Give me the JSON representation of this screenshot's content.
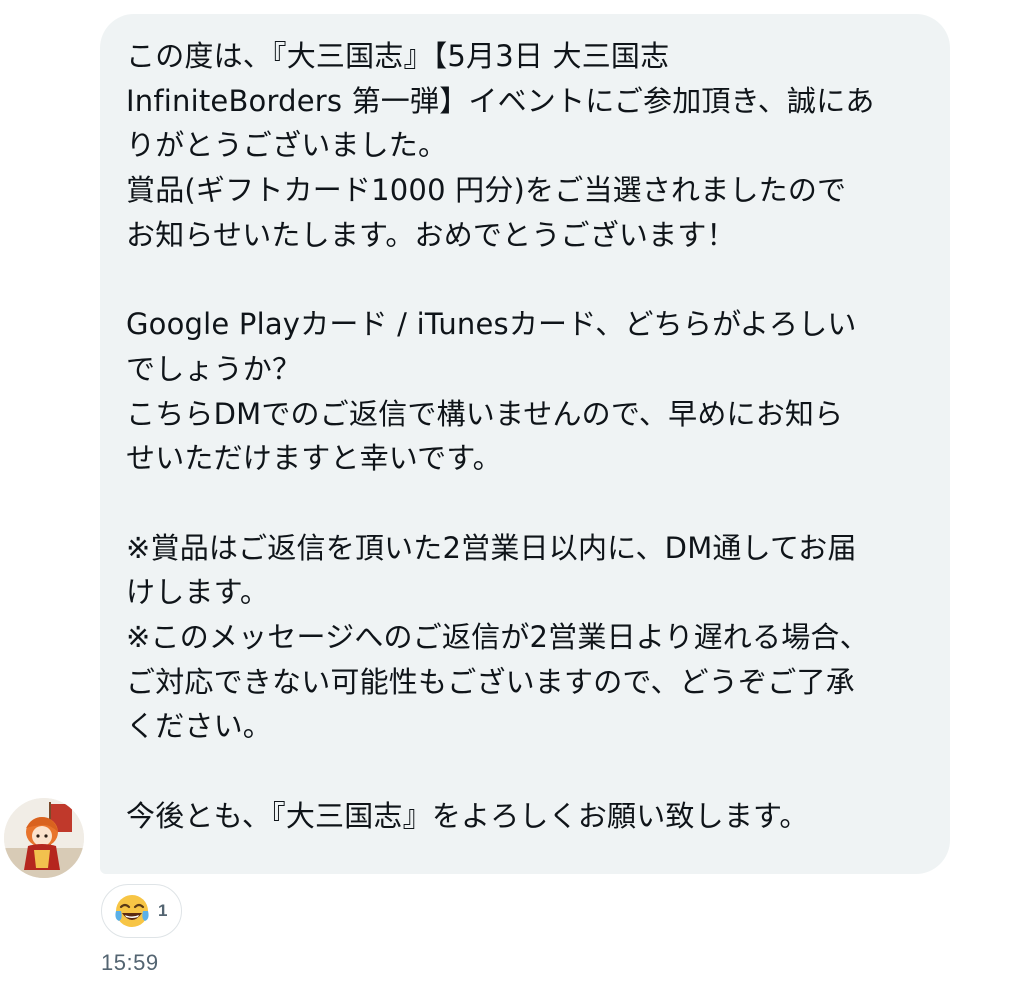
{
  "message": {
    "lines": [
      "この度は、『大三国志』【5月3日 大三国志",
      "InfiniteBorders 第一弾】イベントにご参加頂き、誠にあ",
      "りがとうございました。",
      "賞品(ギフトカード1000 円分)をご当選されましたので",
      "お知らせいたします。おめでとうございます！",
      "",
      "Google Playカード / iTunesカード、どちらがよろしい",
      "でしょうか？",
      "こちらDMでのご返信で構いませんので、早めにお知ら",
      "せいただけますと幸いです。",
      "",
      "※賞品はご返信を頂いた2営業日以内に、DM通してお届",
      "けします。",
      "※このメッセージへのご返信が2営業日より遅れる場合、",
      "ご対応できない可能性もございますので、どうぞご了承",
      "ください。",
      "",
      " 今後とも、『大三国志』をよろしくお願い致します。"
    ]
  },
  "reaction": {
    "emoji_name": "tears-of-joy-emoji",
    "count": "1"
  },
  "timestamp": "15:59",
  "colors": {
    "bubble_bg": "#eff3f4",
    "text": "#0f1419",
    "meta": "#536471"
  }
}
